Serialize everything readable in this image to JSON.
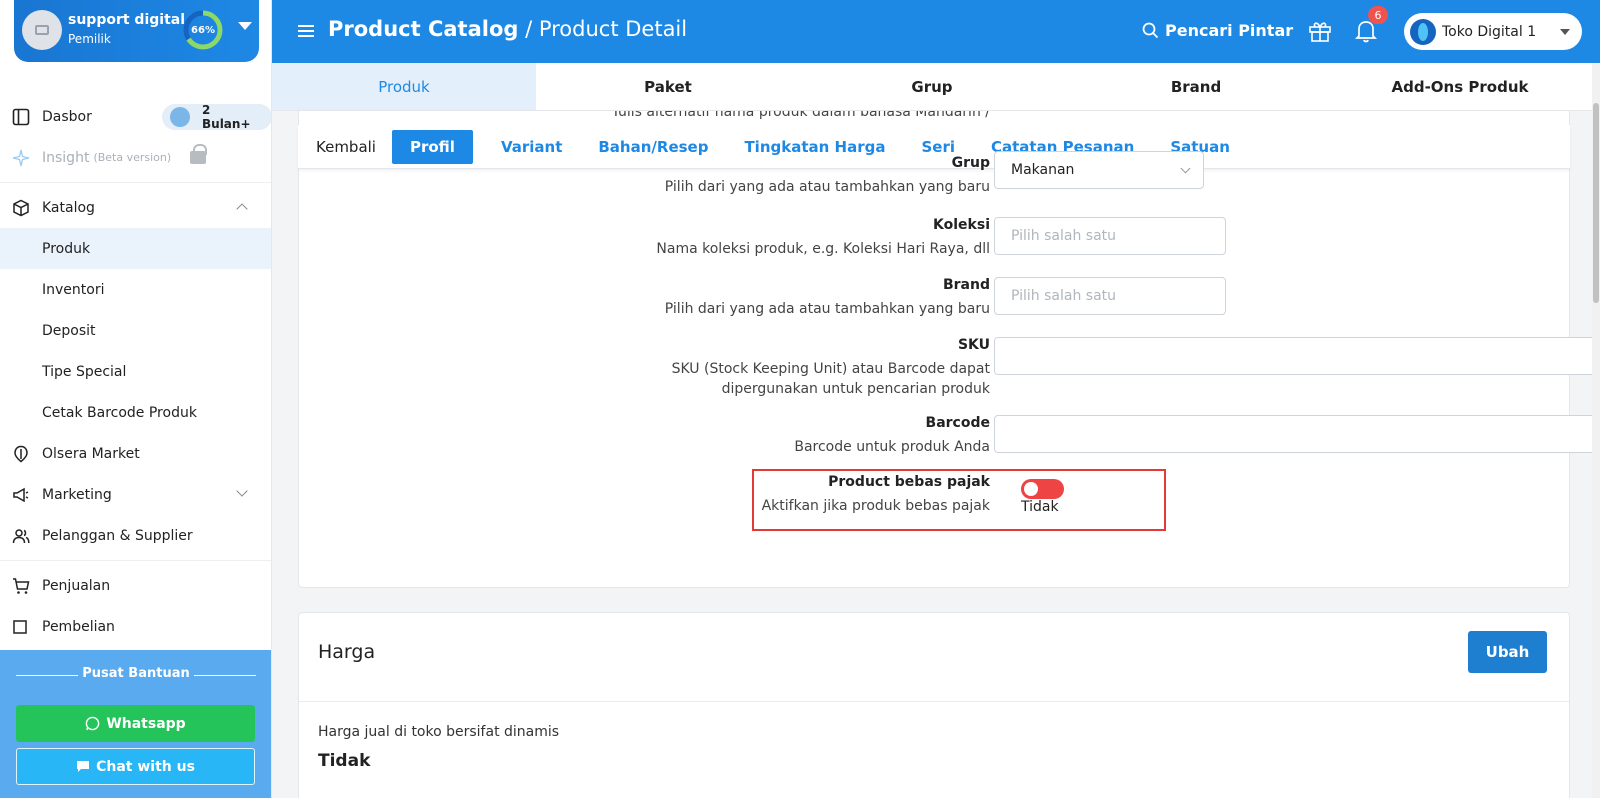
{
  "user": {
    "name": "support digital",
    "role": "Pemilik",
    "progress_label": "66%",
    "progress_value": 0.66
  },
  "sidebar": {
    "dasbor": "Dasbor",
    "badge": "2 Bulan+",
    "insight": "Insight",
    "insight_beta": "(Beta version)",
    "katalog": "Katalog",
    "sub_items": [
      "Produk",
      "Inventori",
      "Deposit",
      "Tipe Special",
      "Cetak Barcode Produk"
    ],
    "olsera_market": "Olsera Market",
    "marketing": "Marketing",
    "pelanggan": "Pelanggan & Supplier",
    "penjualan": "Penjualan",
    "pembelian": "Pembelian"
  },
  "help": {
    "title": "Pusat Bantuan",
    "whatsapp": "Whatsapp",
    "chat": "Chat with us"
  },
  "header": {
    "title_bold": "Product Catalog",
    "title_rest": " / Product Detail",
    "search": "Pencari Pintar",
    "notif_count": "6",
    "store": "Toko Digital 1"
  },
  "top_tabs": [
    "Produk",
    "Paket",
    "Grup",
    "Brand",
    "Add-Ons Produk"
  ],
  "sub_tabs": [
    "Kembali",
    "Profil",
    "Variant",
    "Bahan/Resep",
    "Tingkatan Harga",
    "Seri",
    "Catatan Pesanan",
    "Satuan"
  ],
  "form": {
    "partial_hint": "Tulis alternatif nama produk dalam bahasa Mandarin /",
    "grup": {
      "label": "Grup",
      "hint": "Pilih dari yang ada atau tambahkan yang baru",
      "value": "Makanan"
    },
    "koleksi": {
      "label": "Koleksi",
      "hint": "Nama koleksi produk, e.g. Koleksi Hari Raya, dll",
      "placeholder": "Pilih salah satu"
    },
    "brand": {
      "label": "Brand",
      "hint": "Pilih dari yang ada atau tambahkan yang baru",
      "placeholder": "Pilih salah satu"
    },
    "sku": {
      "label": "SKU",
      "hint_1": "SKU (Stock Keeping Unit) atau Barcode dapat",
      "hint_2": "dipergunakan untuk pencarian produk",
      "value": ""
    },
    "barcode": {
      "label": "Barcode",
      "hint": "Barcode untuk produk Anda",
      "value": ""
    },
    "tax_free": {
      "label": "Product bebas pajak",
      "hint": "Aktifkan jika produk bebas pajak",
      "state": "Tidak"
    }
  },
  "harga": {
    "title": "Harga",
    "button": "Ubah",
    "note": "Harga jual di toko bersifat dinamis",
    "value": "Tidak"
  },
  "colors": {
    "primary": "#1e88e5",
    "toggle_off": "#ef4444",
    "whatsapp": "#25c45a",
    "highlight": "#e53935"
  }
}
